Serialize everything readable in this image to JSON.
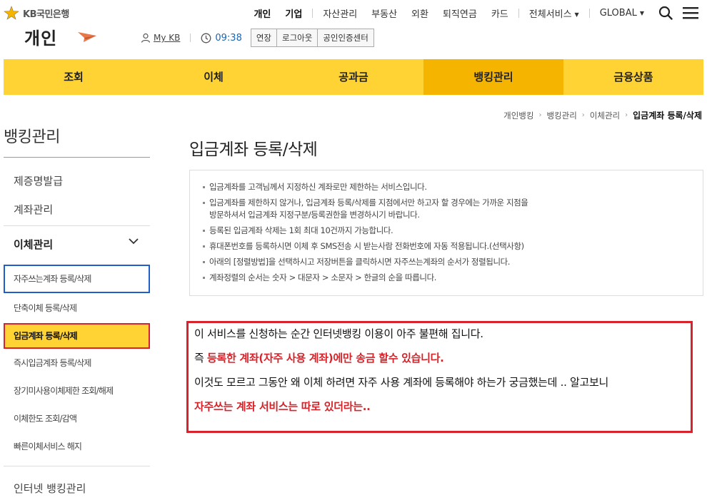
{
  "header": {
    "logo_text": "KB국민은행",
    "brand": "개인",
    "my_kb": "My KB",
    "session_time": "09:38",
    "session_buttons": [
      "연장",
      "로그아웃",
      "공인인증센터"
    ]
  },
  "gnb": {
    "personal": "개인",
    "corporate": "기업",
    "asset": "자산관리",
    "realestate": "부동산",
    "fx": "외환",
    "pension": "퇴직연금",
    "card": "카드",
    "all_services": "전체서비스",
    "global": "GLOBAL"
  },
  "main_nav": [
    "조회",
    "이체",
    "공과금",
    "뱅킹관리",
    "금융상품"
  ],
  "breadcrumb": [
    "개인뱅킹",
    "뱅킹관리",
    "이체관리",
    "입금계좌 등록/삭제"
  ],
  "sidebar": {
    "title": "뱅킹관리",
    "items_top": [
      "제증명발급",
      "계좌관리"
    ],
    "group_title": "이체관리",
    "sub_items": [
      "자주쓰는계좌 등록/삭제",
      "단축이체 등록/삭제",
      "입금계좌 등록/삭제",
      "즉시입금계좌 등록/삭제",
      "장기미사용이체제한 조회/해제",
      "이체한도 조회/감액",
      "빠른이체서비스 해지"
    ],
    "items_bottom": [
      "인터넷 뱅킹관리"
    ]
  },
  "content": {
    "title": "입금계좌 등록/삭제",
    "info": [
      "입금계좌를 고객님께서 지정하신 계좌로만 제한하는 서비스입니다.",
      "입금계좌를 제한하지 않거나, 입금계좌 등록/삭제를 지점에서만 하고자 할 경우에는 가까운 지점을",
      "방문하셔서 입금계좌 지정구분/등록권한을 변경하시기 바랍니다.",
      "등록된 입금계좌 삭제는 1회 최대 10건까지 가능합니다.",
      "휴대폰번호를 등록하시면 이체 후 SMS전송 시 받는사람 전화번호에 자동 적용됩니다.(선택사항)",
      "아래의 [정렬방법]을 선택하시고 저장버튼을 클릭하시면 자주쓰는계좌의 순서가 정렬됩니다.",
      "계좌정렬의 순서는 숫자 > 대문자 > 소문자 > 한글의 순을 따릅니다."
    ]
  },
  "note": {
    "line1": "이 서비스를 신청하는 순간 인터넷뱅킹 이용이 아주 불편해 집니다.",
    "line2_prefix": "즉 ",
    "line2_red": "등록한 계좌(자주 사용 계좌)에만 송금 할수 있습니다.",
    "line3": "이것도 모르고 그동안 왜 이체 하려면 자주 사용 계좌에 등록해야 하는가 궁금했는데 .. 알고보니",
    "line4": "자주쓰는 계좌 서비스는 따로 있더라는.."
  },
  "colors": {
    "nav_yellow": "#ffd333",
    "nav_active": "#f5b400",
    "highlight_red": "#d9232c",
    "highlight_blue": "#1f5fc7",
    "time_blue": "#1a66b2"
  }
}
